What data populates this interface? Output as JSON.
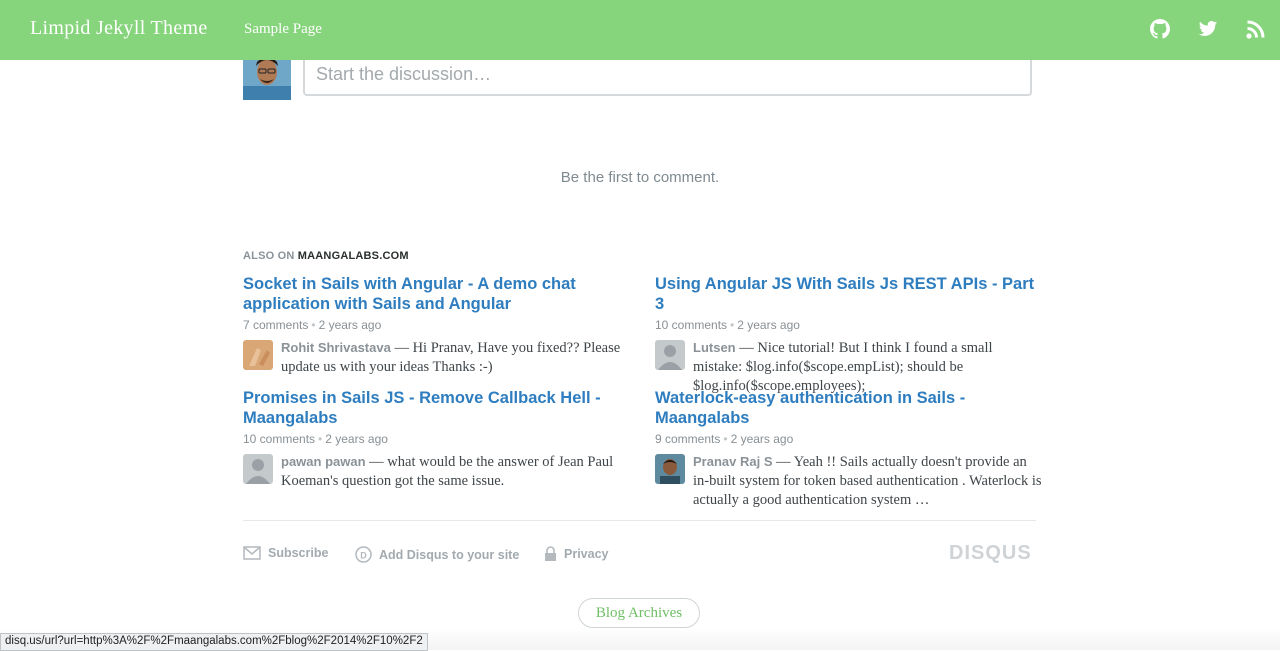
{
  "header": {
    "brand": "Limpid Jekyll Theme",
    "nav_link": "Sample Page",
    "icons": [
      "github-icon",
      "twitter-icon",
      "rss-icon"
    ],
    "bg_color": "#86d47c"
  },
  "disqus": {
    "placeholder": "Start the discussion…",
    "empty_message": "Be the first to comment.",
    "also_on_prefix": "ALSO ON",
    "also_on_site": "MAANGALABS.COM",
    "recommendations": [
      {
        "title": "Socket in Sails with Angular - A demo chat application with Sails and Angular",
        "comments": "7 comments",
        "age": "2 years ago",
        "author": "Rohit Shrivastava",
        "excerpt": "— Hi Pranav, Have you fixed?? Please update us with your ideas Thanks :-)"
      },
      {
        "title": "Using Angular JS With Sails Js REST APIs - Part 3",
        "comments": "10 comments",
        "age": "2 years ago",
        "author": "Lutsen",
        "excerpt": "— Nice tutorial! But I think I found a small mistake: $log.info($scope.empList); should be $log.info($scope.employees);"
      },
      {
        "title": "Promises in Sails JS - Remove Callback Hell - Maangalabs",
        "comments": "10 comments",
        "age": "2 years ago",
        "author": "pawan pawan",
        "excerpt": "— what would be the answer of Jean Paul Koeman's question got the same issue."
      },
      {
        "title": "Waterlock-easy authentication in Sails - Maangalabs",
        "comments": "9 comments",
        "age": "2 years ago",
        "author": "Pranav Raj S",
        "excerpt": "— Yeah !! Sails actually doesn't provide an in-built system for token based authentication . Waterlock is actually a good authentication system …"
      }
    ],
    "footer": {
      "subscribe": "Subscribe",
      "add_disqus": "Add Disqus to your site",
      "privacy": "Privacy",
      "logo": "DISQUS"
    }
  },
  "archives_button": "Blog Archives",
  "status_url": "disq.us/url?url=http%3A%2F%2Fmaangalabs.com%2Fblog%2F2014%2F10%2F2"
}
